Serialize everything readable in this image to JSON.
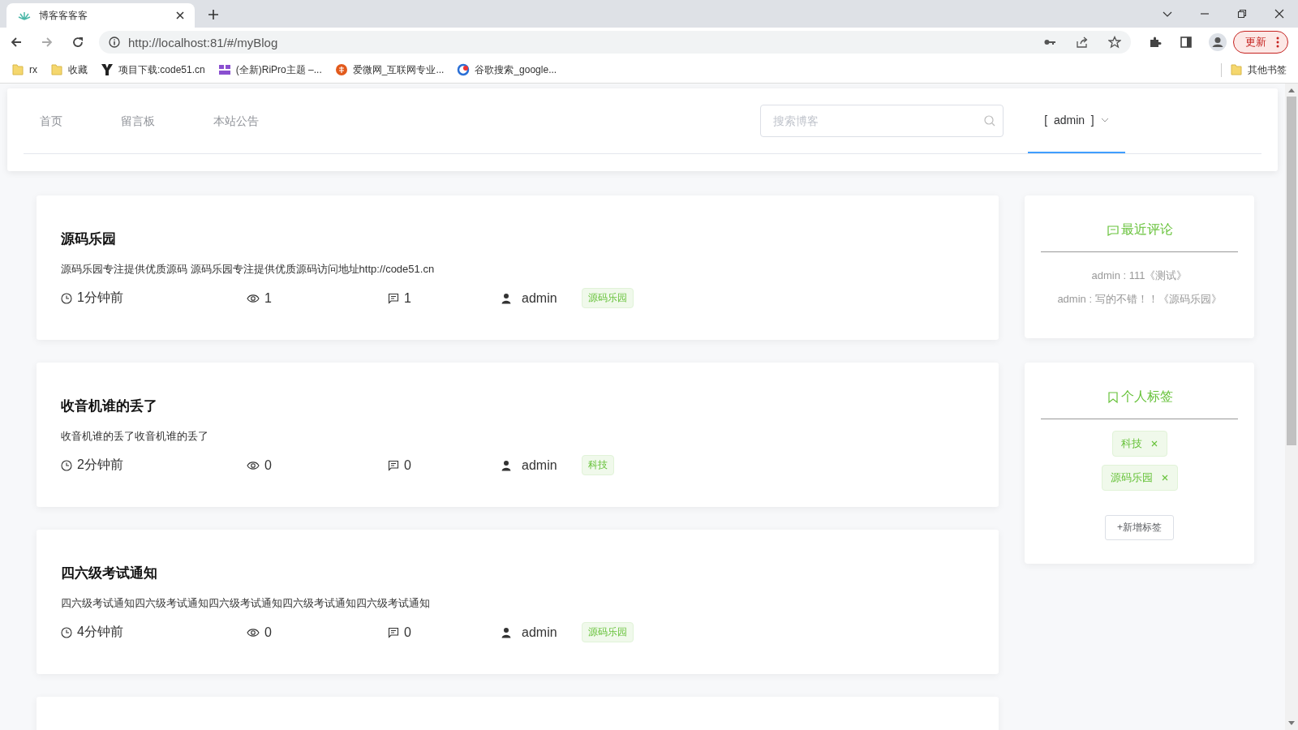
{
  "browser": {
    "tab_title": "博客客客客",
    "url": "http://localhost:81/#/myBlog",
    "update_button": "更新",
    "bookmarks": [
      {
        "label": "rx",
        "kind": "folder"
      },
      {
        "label": "收藏",
        "kind": "folder"
      },
      {
        "label": "项目下载:code51.cn",
        "kind": "y"
      },
      {
        "label": "(全新)RiPro主题 –...",
        "kind": "purple"
      },
      {
        "label": "爱微网_互联网专业...",
        "kind": "orange"
      },
      {
        "label": "谷歌搜索_google...",
        "kind": "blue"
      }
    ],
    "other_bookmarks": "其他书签"
  },
  "nav": {
    "items": [
      {
        "label": "首页",
        "selected": false
      },
      {
        "label": "留言板",
        "selected": false
      },
      {
        "label": "本站公告",
        "selected": false
      }
    ],
    "search": {
      "placeholder": "搜索博客"
    },
    "user_menu": {
      "label": "[  admin  ]",
      "selected": true
    }
  },
  "posts": [
    {
      "title": "源码乐园",
      "summary": "源码乐园专注提供优质源码 源码乐园专注提供优质源码访问地址http://code51.cn",
      "time": "1分钟前",
      "views": "1",
      "comments": "1",
      "author": "admin",
      "tag": "源码乐园"
    },
    {
      "title": "收音机谁的丢了",
      "summary": "收音机谁的丢了收音机谁的丢了",
      "time": "2分钟前",
      "views": "0",
      "comments": "0",
      "author": "admin",
      "tag": "科技"
    },
    {
      "title": "四六级考试通知",
      "summary": "四六级考试通知四六级考试通知四六级考试通知四六级考试通知四六级考试通知",
      "time": "4分钟前",
      "views": "0",
      "comments": "0",
      "author": "admin",
      "tag": "源码乐园"
    }
  ],
  "recent_comments": {
    "title": "最近评论",
    "items": [
      "admin : 111《测试》",
      "admin : 写的不错！！《源码乐园》"
    ]
  },
  "personal_tags": {
    "title": "个人标签",
    "tags": [
      "科技",
      "源码乐园"
    ],
    "add_button": "+新增标签"
  }
}
